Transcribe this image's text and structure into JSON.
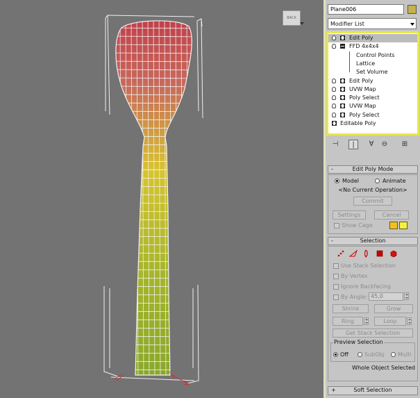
{
  "viewport": {
    "viewcube_label": "BACK",
    "mesh_color_top": "#c2404a",
    "mesh_color_mid": "#d8c42e",
    "mesh_color_bottom": "#8aa82a",
    "lattice_color": "#f0f0f0",
    "gizmo_color": "#d03030"
  },
  "command_panel": {
    "object_name": "Plane006",
    "object_color": "#c4b24a",
    "modifier_list_label": "Modifier List",
    "stack": [
      {
        "label": "Edit Poly",
        "expander": "plus",
        "selected": true
      },
      {
        "label": "FFD 4x4x4",
        "expander": "minus",
        "selected": false
      },
      {
        "label": "Control Points",
        "sub": true
      },
      {
        "label": "Lattice",
        "sub": true
      },
      {
        "label": "Set Volume",
        "sub": true
      },
      {
        "label": "Edit Poly",
        "expander": "plus"
      },
      {
        "label": "UVW Map",
        "expander": "plus"
      },
      {
        "label": "Poly Select",
        "expander": "plus"
      },
      {
        "label": "UVW Map",
        "expander": "plus"
      },
      {
        "label": "Poly Select",
        "expander": "plus"
      },
      {
        "label": "Editable Poly",
        "expander": "plus",
        "no_bulb": true
      }
    ],
    "stack_toolbar_icons": [
      "pin-stack-icon",
      "show-end-result-icon",
      "make-unique-icon",
      "remove-modifier-icon",
      "configure-sets-icon"
    ],
    "edit_poly_mode": {
      "title": "Edit Poly Mode",
      "sign": "-",
      "model_label": "Model",
      "animate_label": "Animate",
      "mode_selected": "Model",
      "current_operation": "<No Current Operation>",
      "commit_label": "Commit",
      "settings_label": "Settings",
      "cancel_label": "Cancel",
      "show_cage_label": "Show Cage",
      "cage_color_1": "#f2c21b",
      "cage_color_2": "#f6f23a"
    },
    "selection": {
      "title": "Selection",
      "sign": "-",
      "level_icons": [
        "vertex-icon",
        "edge-icon",
        "border-icon",
        "polygon-icon",
        "element-icon"
      ],
      "use_stack_selection": "Use Stack Selection",
      "by_vertex": "By Vertex",
      "ignore_backfacing": "Ignore Backfacing",
      "by_angle": "By Angle:",
      "angle_value": "45,0",
      "shrink_label": "Shrink",
      "grow_label": "Grow",
      "ring_label": "Ring",
      "loop_label": "Loop",
      "get_stack_selection": "Get Stack Selection",
      "preview_title": "Preview Selection",
      "preview_off": "Off",
      "preview_subobj": "SubObj",
      "preview_multi": "Multi",
      "preview_selected": "Off",
      "status": "Whole Object Selected"
    },
    "soft_selection": {
      "title": "Soft Selection",
      "sign": "+"
    }
  }
}
